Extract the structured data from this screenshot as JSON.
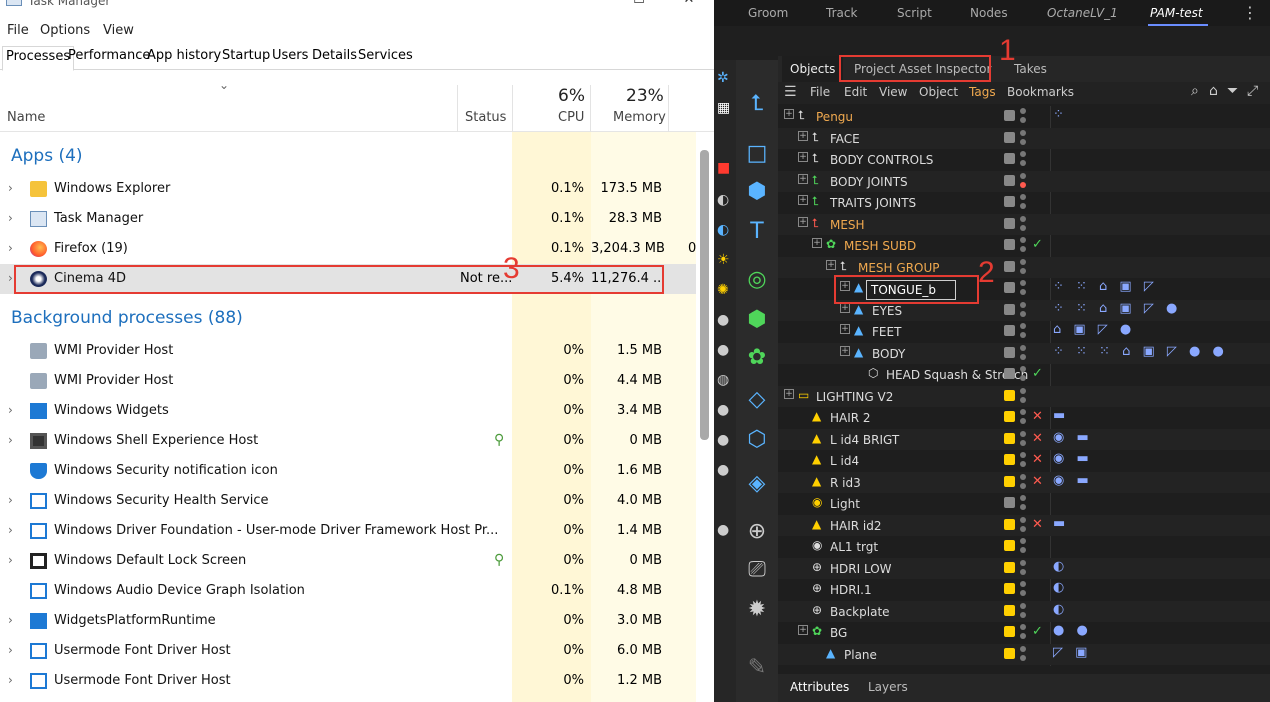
{
  "task_manager": {
    "title": "Task Manager",
    "menu": [
      "File",
      "Options",
      "View"
    ],
    "tabs": [
      "Processes",
      "Performance",
      "App history",
      "Startup",
      "Users",
      "Details",
      "Services"
    ],
    "active_tab": "Processes",
    "header": {
      "name_label": "Name",
      "status_label": "Status",
      "cpu_pct": "6%",
      "cpu_label": "CPU",
      "mem_pct": "23%",
      "mem_label": "Memory"
    },
    "apps_section": "Apps (4)",
    "apps": [
      {
        "name": "Windows Explorer",
        "status": "",
        "cpu": "0.1%",
        "mem": "173.5 MB",
        "icon": "folder-icon"
      },
      {
        "name": "Task Manager",
        "status": "",
        "cpu": "0.1%",
        "mem": "28.3 MB",
        "icon": "taskmgr-icon"
      },
      {
        "name": "Firefox (19)",
        "status": "",
        "cpu": "0.1%",
        "mem": "3,204.3 MB",
        "icon": "firefox-icon",
        "extra": "0"
      },
      {
        "name": "Cinema 4D",
        "status": "Not re...",
        "cpu": "5.4%",
        "mem": "11,276.4 ...",
        "icon": "cinema4d-icon"
      }
    ],
    "bg_section": "Background processes (88)",
    "background": [
      {
        "name": "WMI Provider Host",
        "cpu": "0%",
        "mem": "1.5 MB",
        "expand": false
      },
      {
        "name": "WMI Provider Host",
        "cpu": "0%",
        "mem": "4.4 MB",
        "expand": false
      },
      {
        "name": "Windows Widgets",
        "cpu": "0%",
        "mem": "3.4 MB",
        "expand": true
      },
      {
        "name": "Windows Shell Experience Host",
        "cpu": "0%",
        "mem": "0 MB",
        "expand": true,
        "leaf": true
      },
      {
        "name": "Windows Security notification icon",
        "cpu": "0%",
        "mem": "1.6 MB",
        "expand": false
      },
      {
        "name": "Windows Security Health Service",
        "cpu": "0%",
        "mem": "4.0 MB",
        "expand": true
      },
      {
        "name": "Windows Driver Foundation - User-mode Driver Framework Host Pr...",
        "cpu": "0%",
        "mem": "1.4 MB",
        "expand": true
      },
      {
        "name": "Windows Default Lock Screen",
        "cpu": "0%",
        "mem": "0 MB",
        "expand": true,
        "leaf": true
      },
      {
        "name": "Windows Audio Device Graph Isolation",
        "cpu": "0.1%",
        "mem": "4.8 MB",
        "expand": false
      },
      {
        "name": "WidgetsPlatformRuntime",
        "cpu": "0%",
        "mem": "3.0 MB",
        "expand": true
      },
      {
        "name": "Usermode Font Driver Host",
        "cpu": "0%",
        "mem": "6.0 MB",
        "expand": true
      },
      {
        "name": "Usermode Font Driver Host",
        "cpu": "0%",
        "mem": "1.2 MB",
        "expand": true
      }
    ]
  },
  "c4d": {
    "top_tabs": [
      "Groom",
      "Track",
      "Script",
      "Nodes",
      "OctaneLV_1",
      "PAM-test"
    ],
    "om_tabs": [
      "Objects",
      "Project Asset Inspector",
      "Takes"
    ],
    "om_menu": [
      "File",
      "Edit",
      "View",
      "Object",
      "Tags",
      "Bookmarks"
    ],
    "objects": [
      {
        "name": "Pengu",
        "color": "#f0a94f",
        "indent": 0,
        "chk": "g",
        "mark": "",
        "tags": "⁘"
      },
      {
        "name": "FACE",
        "color": "#ddd",
        "indent": 1,
        "chk": "g",
        "mark": "",
        "tags": ""
      },
      {
        "name": "BODY CONTROLS",
        "color": "#ddd",
        "indent": 1,
        "chk": "g",
        "mark": "",
        "tags": ""
      },
      {
        "name": "BODY JOINTS",
        "color": "#ddd",
        "indent": 1,
        "chk": "g",
        "d2": "r",
        "mark": "",
        "tags": ""
      },
      {
        "name": "TRAITS JOINTS",
        "color": "#ddd",
        "indent": 1,
        "chk": "g",
        "mark": "",
        "tags": ""
      },
      {
        "name": "MESH",
        "color": "#f0a94f",
        "indent": 1,
        "chk": "g",
        "mark": "",
        "tags": ""
      },
      {
        "name": "MESH SUBD",
        "color": "#f0a94f",
        "indent": 2,
        "chk": "g",
        "mark": "✓",
        "tags": ""
      },
      {
        "name": "MESH GROUP",
        "color": "#f0a94f",
        "indent": 3,
        "chk": "g",
        "mark": "",
        "tags": ""
      },
      {
        "name": "TONGUE_b",
        "color": "#ddd",
        "indent": 4,
        "chk": "g",
        "mark": "",
        "tags": "⁘ ⁙ ⌂ ▣ ◸"
      },
      {
        "name": "EYES",
        "color": "#ddd",
        "indent": 4,
        "chk": "g",
        "mark": "",
        "tags": "⁘ ⁙ ⌂ ▣ ◸ ●"
      },
      {
        "name": "FEET",
        "color": "#ddd",
        "indent": 4,
        "chk": "g",
        "mark": "",
        "tags": "⌂ ▣ ◸ ●"
      },
      {
        "name": "BODY",
        "color": "#ddd",
        "indent": 4,
        "chk": "g",
        "mark": "",
        "tags": "⁘ ⁙ ⁙ ⌂ ▣ ◸ ● ●"
      },
      {
        "name": "HEAD Squash & Stretch",
        "color": "#ddd",
        "indent": 5,
        "chk": "g",
        "mark": "✓",
        "tags": ""
      },
      {
        "name": "LIGHTING V2",
        "color": "#ddd",
        "indent": 0,
        "chk": "y",
        "mark": "",
        "tags": ""
      },
      {
        "name": "HAIR 2",
        "color": "#ddd",
        "indent": 1,
        "chk": "y",
        "mark": "✕",
        "tags": "▬"
      },
      {
        "name": "L id4 BRIGT",
        "color": "#ddd",
        "indent": 1,
        "chk": "y",
        "mark": "✕",
        "tags": "◉ ▬"
      },
      {
        "name": "L id4",
        "color": "#ddd",
        "indent": 1,
        "chk": "y",
        "mark": "✕",
        "tags": "◉ ▬"
      },
      {
        "name": "R id3",
        "color": "#ddd",
        "indent": 1,
        "chk": "y",
        "mark": "✕",
        "tags": "◉ ▬"
      },
      {
        "name": "Light",
        "color": "#ddd",
        "indent": 1,
        "chk": "g",
        "mark": "",
        "tags": ""
      },
      {
        "name": "HAIR id2",
        "color": "#ddd",
        "indent": 1,
        "chk": "y",
        "mark": "✕",
        "tags": "▬"
      },
      {
        "name": "AL1 trgt",
        "color": "#ddd",
        "indent": 1,
        "chk": "y",
        "mark": "",
        "tags": ""
      },
      {
        "name": "HDRI LOW",
        "color": "#ddd",
        "indent": 1,
        "chk": "y",
        "mark": "",
        "tags": "◐"
      },
      {
        "name": "HDRI.1",
        "color": "#ddd",
        "indent": 1,
        "chk": "y",
        "mark": "",
        "tags": "◐"
      },
      {
        "name": "Backplate",
        "color": "#ddd",
        "indent": 1,
        "chk": "y",
        "mark": "",
        "tags": "◐"
      },
      {
        "name": "BG",
        "color": "#ddd",
        "indent": 1,
        "chk": "y",
        "mark": "✓",
        "tags": "● ●"
      },
      {
        "name": "Plane",
        "color": "#ddd",
        "indent": 2,
        "chk": "y",
        "mark": "",
        "tags": "◸ ▣"
      }
    ],
    "rename_value": "TONGUE_b",
    "bottom_tabs": [
      "Attributes",
      "Layers"
    ]
  },
  "annotations": [
    "1",
    "2",
    "3"
  ]
}
